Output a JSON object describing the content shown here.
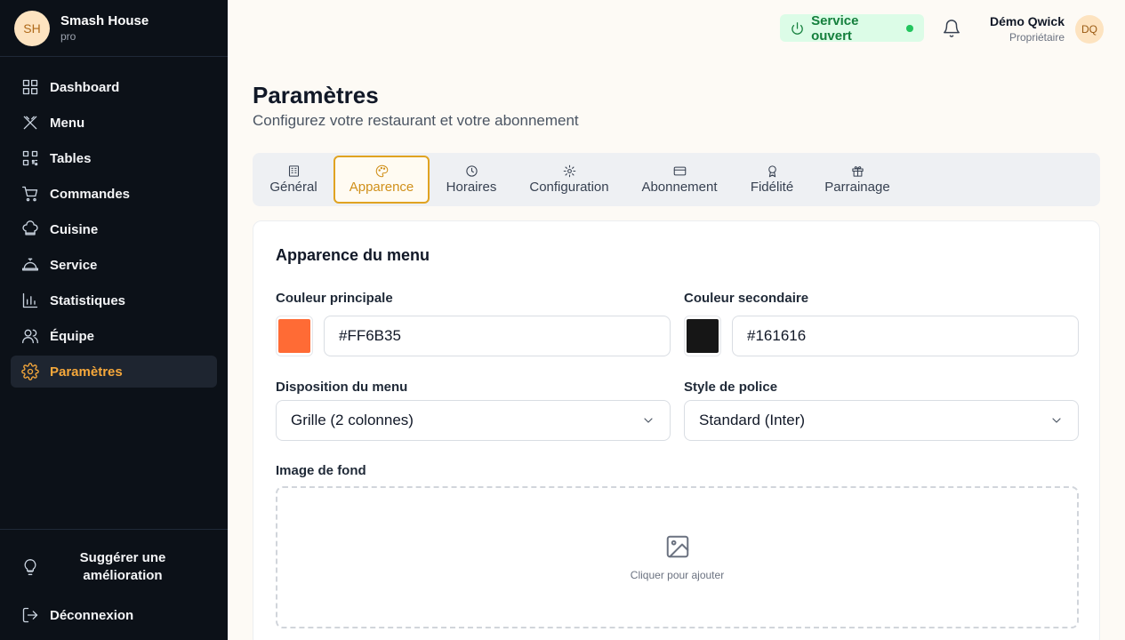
{
  "sidebar": {
    "brand": {
      "initials": "SH",
      "name": "Smash House",
      "plan": "pro"
    },
    "items": [
      {
        "label": "Dashboard",
        "icon": "dashboard-icon"
      },
      {
        "label": "Menu",
        "icon": "utensils-icon"
      },
      {
        "label": "Tables",
        "icon": "qr-code-icon"
      },
      {
        "label": "Commandes",
        "icon": "cart-icon"
      },
      {
        "label": "Cuisine",
        "icon": "chef-hat-icon"
      },
      {
        "label": "Service",
        "icon": "bell-service-icon"
      },
      {
        "label": "Statistiques",
        "icon": "chart-icon"
      },
      {
        "label": "Équipe",
        "icon": "users-icon"
      },
      {
        "label": "Paramètres",
        "icon": "gear-icon",
        "active": true
      }
    ],
    "suggest_label": "Suggérer une amélioration",
    "logout_label": "Déconnexion"
  },
  "header": {
    "service_status": "Service ouvert",
    "user": {
      "name": "Démo Qwick",
      "role": "Propriétaire",
      "initials": "DQ"
    }
  },
  "page": {
    "title": "Paramètres",
    "subtitle": "Configurez votre restaurant et votre abonnement"
  },
  "tabs": [
    {
      "label": "Général",
      "icon": "building-icon"
    },
    {
      "label": "Apparence",
      "icon": "palette-icon",
      "active": true
    },
    {
      "label": "Horaires",
      "icon": "clock-icon"
    },
    {
      "label": "Configuration",
      "icon": "gear-icon"
    },
    {
      "label": "Abonnement",
      "icon": "credit-card-icon"
    },
    {
      "label": "Fidélité",
      "icon": "award-icon"
    },
    {
      "label": "Parrainage",
      "icon": "gift-icon"
    }
  ],
  "appearance": {
    "section_title": "Apparence du menu",
    "primary_color": {
      "label": "Couleur principale",
      "value": "#FF6B35"
    },
    "secondary_color": {
      "label": "Couleur secondaire",
      "value": "#161616"
    },
    "layout": {
      "label": "Disposition du menu",
      "value": "Grille (2 colonnes)"
    },
    "font_style": {
      "label": "Style de police",
      "value": "Standard (Inter)"
    },
    "background_image": {
      "label": "Image de fond",
      "placeholder": "Cliquer pour ajouter"
    }
  },
  "colors": {
    "accent": "#F6A83B",
    "sidebar_bg": "#0C1118",
    "service_green": "#15803D"
  }
}
